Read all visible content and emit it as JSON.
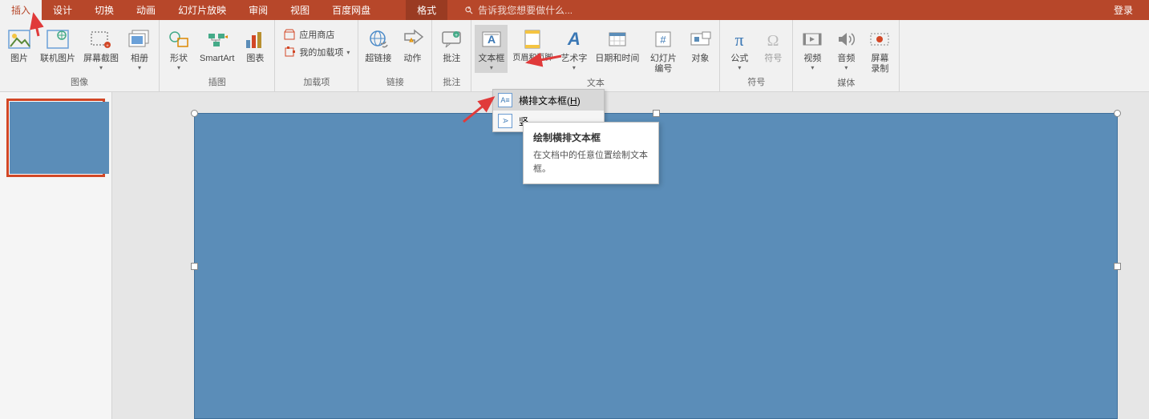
{
  "tabs": {
    "insert": "插入",
    "design": "设计",
    "transition": "切换",
    "animation": "动画",
    "slideshow": "幻灯片放映",
    "review": "审阅",
    "view": "视图",
    "baidu": "百度网盘",
    "format": "格式",
    "search_hint": "告诉我您想要做什么...",
    "login": "登录"
  },
  "ribbon": {
    "image": {
      "label": "图像",
      "picture": "图片",
      "online_picture": "联机图片",
      "screenshot": "屏幕截图",
      "album": "相册"
    },
    "illustration": {
      "label": "插图",
      "shapes": "形状",
      "smartart": "SmartArt",
      "chart": "图表"
    },
    "addins": {
      "label": "加载项",
      "store": "应用商店",
      "myaddins": "我的加载项"
    },
    "link": {
      "label": "链接",
      "hyperlink": "超链接",
      "action": "动作"
    },
    "comment": {
      "label": "批注",
      "comment": "批注"
    },
    "text": {
      "label": "文本",
      "textbox": "文本框",
      "header_footer": "页眉和页脚",
      "wordart": "艺术字",
      "datetime": "日期和时间",
      "slide_number": "幻灯片编号",
      "object": "对象"
    },
    "symbol": {
      "label": "符号",
      "equation": "公式",
      "symbol": "符号"
    },
    "media": {
      "label": "媒体",
      "video": "视频",
      "audio": "音频",
      "screen_record": "屏幕录制"
    }
  },
  "dropdown": {
    "horizontal_textbox": "横排文本框",
    "horizontal_textbox_key": "H",
    "vertical_prefix": "竖"
  },
  "tooltip": {
    "title": "绘制横排文本框",
    "desc": "在文档中的任意位置绘制文本框。"
  }
}
